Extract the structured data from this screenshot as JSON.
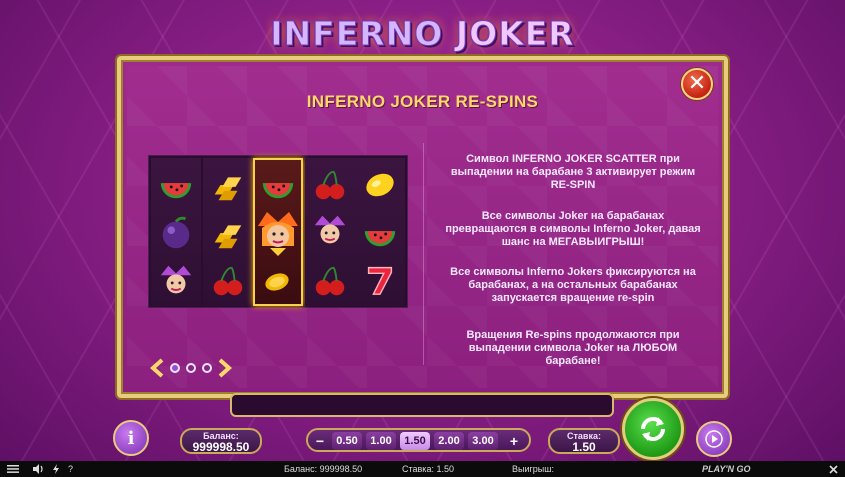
{
  "game": {
    "logo_text_a": "INFERNO",
    "logo_text_b": "JOKER"
  },
  "paytable": {
    "title": "INFERNO JOKER RE-SPINS",
    "rules": [
      "Символ INFERNO JOKER SCATTER при выпадении на барабане 3 активирует режим RE-SPIN",
      "Все символы Joker на барабанах превращаются в символы Inferno Joker, давая шанс на МЕГАВЫИГРЫШ!",
      "Все символы Inferno Jokers фиксируются на барабанах, а на остальных барабанах запускается вращение re-spin",
      "Вращения Re-spins продолжаются при выпадении символа Joker на ЛЮБОМ барабане!"
    ],
    "page_current": 1,
    "page_count": 3,
    "reels": [
      [
        "watermelon",
        "plum",
        "joker-purple"
      ],
      [
        "gold-bars",
        "gold-bars",
        "cherries"
      ],
      [
        "watermelon",
        "inferno-joker",
        "gold-coin"
      ],
      [
        "cherries",
        "joker-purple",
        "cherries"
      ],
      [
        "lemon",
        "watermelon",
        "seven"
      ]
    ],
    "highlight_reel": 3
  },
  "controls": {
    "balance_label": "Баланс:",
    "balance_value": "999998.50",
    "bets": [
      "0.50",
      "1.00",
      "1.50",
      "2.00",
      "3.00"
    ],
    "selected_bet": "1.50",
    "minus": "−",
    "plus": "+",
    "stake_label": "Ставка:",
    "stake_value": "1.50",
    "info": "i"
  },
  "statusbar": {
    "balance": "Баланс: 999998.50",
    "stake": "Ставка: 1.50",
    "win": "Выигрыш:",
    "help": "?",
    "provider": "PLAY'N GO"
  },
  "colors": {
    "gold": "#e7cc7e",
    "title_yellow": "#ffd76a",
    "panel": "#9e2a8c",
    "spin_green": "#2fbf22"
  },
  "icons": {
    "close": "close-icon",
    "info": "info-icon",
    "spin": "spin-arrows-icon",
    "autoplay": "play-icon",
    "menu": "hamburger-menu-icon",
    "sound": "speaker-icon",
    "turbo": "lightning-icon",
    "fullscreen": "close-x-icon"
  }
}
